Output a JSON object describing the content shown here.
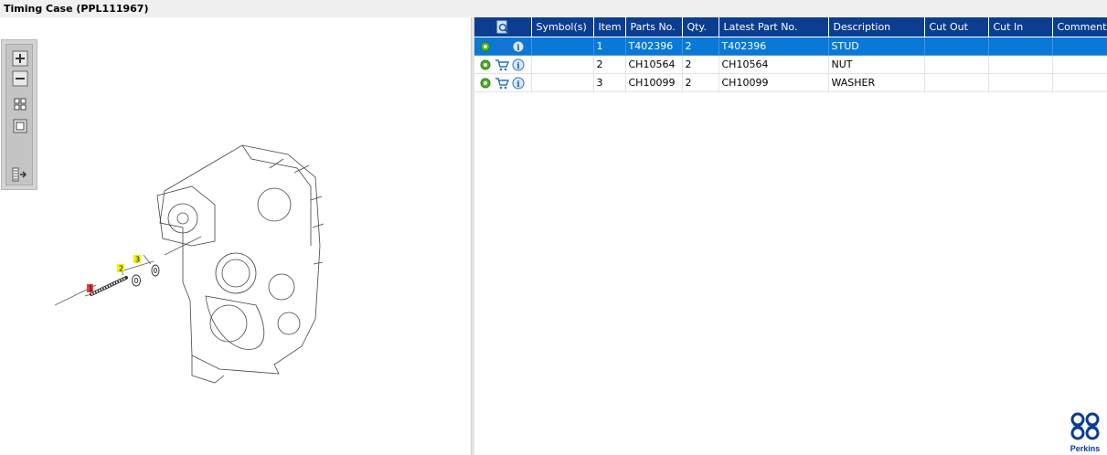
{
  "window": {
    "title": "Timing Case (PPL111967)"
  },
  "toolbar": {
    "buttons": [
      "zoom-in",
      "zoom-out",
      "fit-all",
      "fit-window",
      "toggle-list"
    ]
  },
  "diagram": {
    "callouts": [
      {
        "label": "1",
        "color": "#e8413b"
      },
      {
        "label": "2",
        "color": "#f2f200"
      },
      {
        "label": "3",
        "color": "#f2f200"
      }
    ]
  },
  "grid": {
    "header_icon": "search-document-icon",
    "columns": [
      "Symbol(s)",
      "Item",
      "Parts No.",
      "Qty.",
      "Latest Part No.",
      "Description",
      "Cut Out",
      "Cut In",
      "Comment"
    ],
    "rows": [
      {
        "symbols": "",
        "item": "1",
        "parts_no": "T402396",
        "qty": "2",
        "latest_part_no": "T402396",
        "description": "STUD",
        "cut_out": "",
        "cut_in": "",
        "comment": "",
        "selected": true
      },
      {
        "symbols": "",
        "item": "2",
        "parts_no": "CH10564",
        "qty": "2",
        "latest_part_no": "CH10564",
        "description": "NUT",
        "cut_out": "",
        "cut_in": "",
        "comment": "",
        "selected": false
      },
      {
        "symbols": "",
        "item": "3",
        "parts_no": "CH10099",
        "qty": "2",
        "latest_part_no": "CH10099",
        "description": "WASHER",
        "cut_out": "",
        "cut_in": "",
        "comment": "",
        "selected": false
      }
    ]
  },
  "brand": {
    "name": "Perkins",
    "color": "#0b3d91"
  },
  "colors": {
    "header_bg": "#0b3d91",
    "selected_row": "#0a78d7"
  }
}
